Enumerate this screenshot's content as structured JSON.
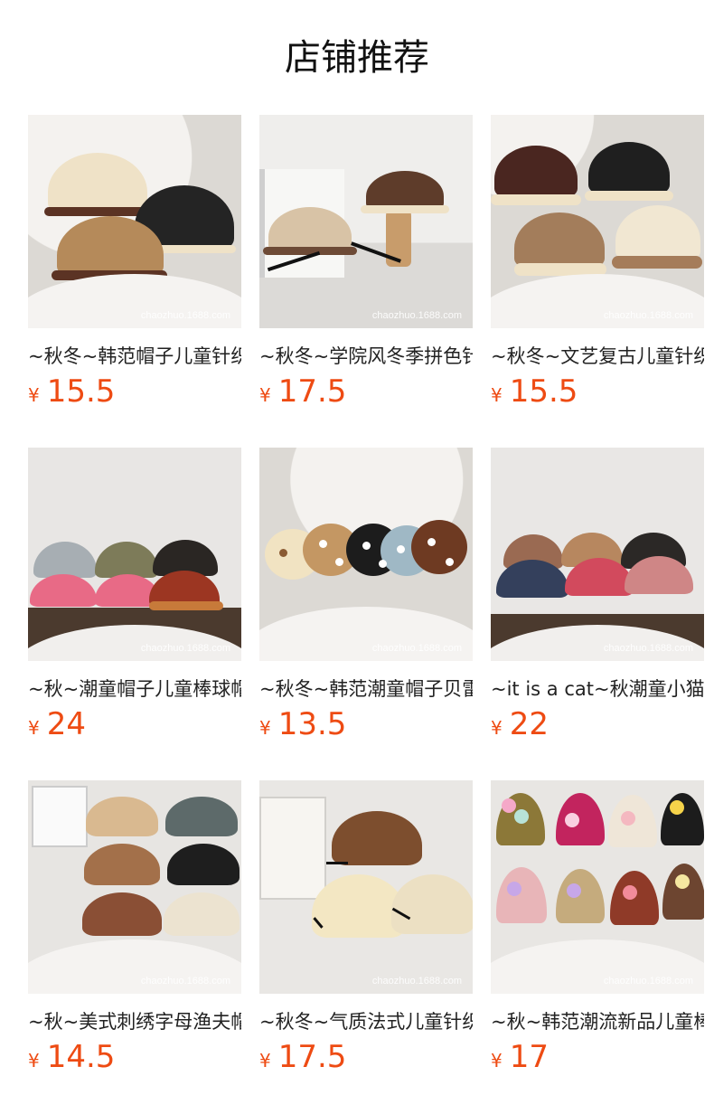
{
  "title": "店铺推荐",
  "watermark": "chaozhuo.1688.com",
  "currency_symbol": "¥",
  "colors": {
    "price": "#ee4b13"
  },
  "products": [
    {
      "name": "~秋冬~韩范帽子儿童针织渔夫帽",
      "price": "15.5"
    },
    {
      "name": "~秋冬~学院风冬季拼色针织帽",
      "price": "17.5"
    },
    {
      "name": "~秋冬~文艺复古儿童针织帽",
      "price": "15.5"
    },
    {
      "name": "~秋~潮童帽子儿童棒球帽",
      "price": "24"
    },
    {
      "name": "~秋冬~韩范潮童帽子贝雷帽",
      "price": "13.5"
    },
    {
      "name": "~it is a cat~秋潮童小猫棒球帽",
      "price": "22"
    },
    {
      "name": "~秋~美式刺绣字母渔夫帽",
      "price": "14.5"
    },
    {
      "name": "~秋冬~气质法式儿童针织帽",
      "price": "17.5"
    },
    {
      "name": "~秋~韩范潮流新品儿童棒球帽",
      "price": "17"
    }
  ]
}
